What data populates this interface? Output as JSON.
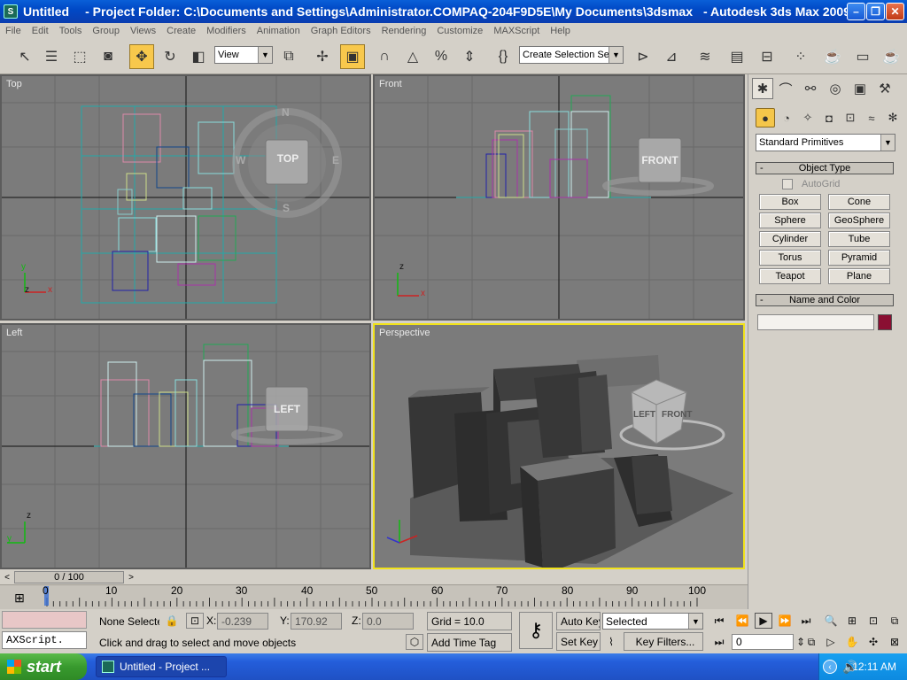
{
  "window": {
    "title": "Untitled",
    "project": "- Project Folder: C:\\Documents and Settings\\Administrator.COMPAQ-204F9D5E\\My Documents\\3dsmax",
    "app": "- Autodesk 3ds Max  2009"
  },
  "menu": [
    "File",
    "Edit",
    "Tools",
    "Group",
    "Views",
    "Create",
    "Modifiers",
    "Animation",
    "Graph Editors",
    "Rendering",
    "Customize",
    "MAXScript",
    "Help"
  ],
  "toolbar": {
    "reference_coord": "View",
    "selection_set": "Create Selection Set"
  },
  "viewports": {
    "top": {
      "label": "Top",
      "viewcube": "TOP",
      "compass": [
        "N",
        "E",
        "S",
        "W"
      ]
    },
    "front": {
      "label": "Front",
      "viewcube": "FRONT"
    },
    "left": {
      "label": "Left",
      "viewcube": "LEFT"
    },
    "perspective": {
      "label": "Perspective",
      "viewcube_faces": [
        "LEFT",
        "FRONT"
      ]
    }
  },
  "command_panel": {
    "category": "Standard Primitives",
    "object_type_title": "Object Type",
    "autogrid": "AutoGrid",
    "buttons": [
      "Box",
      "Cone",
      "Sphere",
      "GeoSphere",
      "Cylinder",
      "Tube",
      "Torus",
      "Pyramid",
      "Teapot",
      "Plane"
    ],
    "name_color_title": "Name and Color",
    "name_value": "",
    "color": "#8a0f32"
  },
  "timeline": {
    "frame_display": "0 / 100",
    "ticks": [
      "0",
      "10",
      "20",
      "30",
      "40",
      "50",
      "60",
      "70",
      "80",
      "90",
      "100"
    ]
  },
  "status": {
    "selection": "None Selecte",
    "x_label": "X:",
    "x_value": "-0.239",
    "y_label": "Y:",
    "y_value": "170.92",
    "z_label": "Z:",
    "z_value": "0.0",
    "grid": "Grid = 10.0",
    "auto_key": "Auto Key",
    "key_mode": "Selected",
    "set_key": "Set Key",
    "key_filters": "Key Filters...",
    "frame": "0",
    "prompt": "Click and drag to select and move objects",
    "add_time_tag": "Add Time Tag",
    "maxscript_listener": "AXScript."
  },
  "taskbar": {
    "start": "start",
    "task": "Untitled     - Project ...",
    "clock": "12:11 AM"
  }
}
